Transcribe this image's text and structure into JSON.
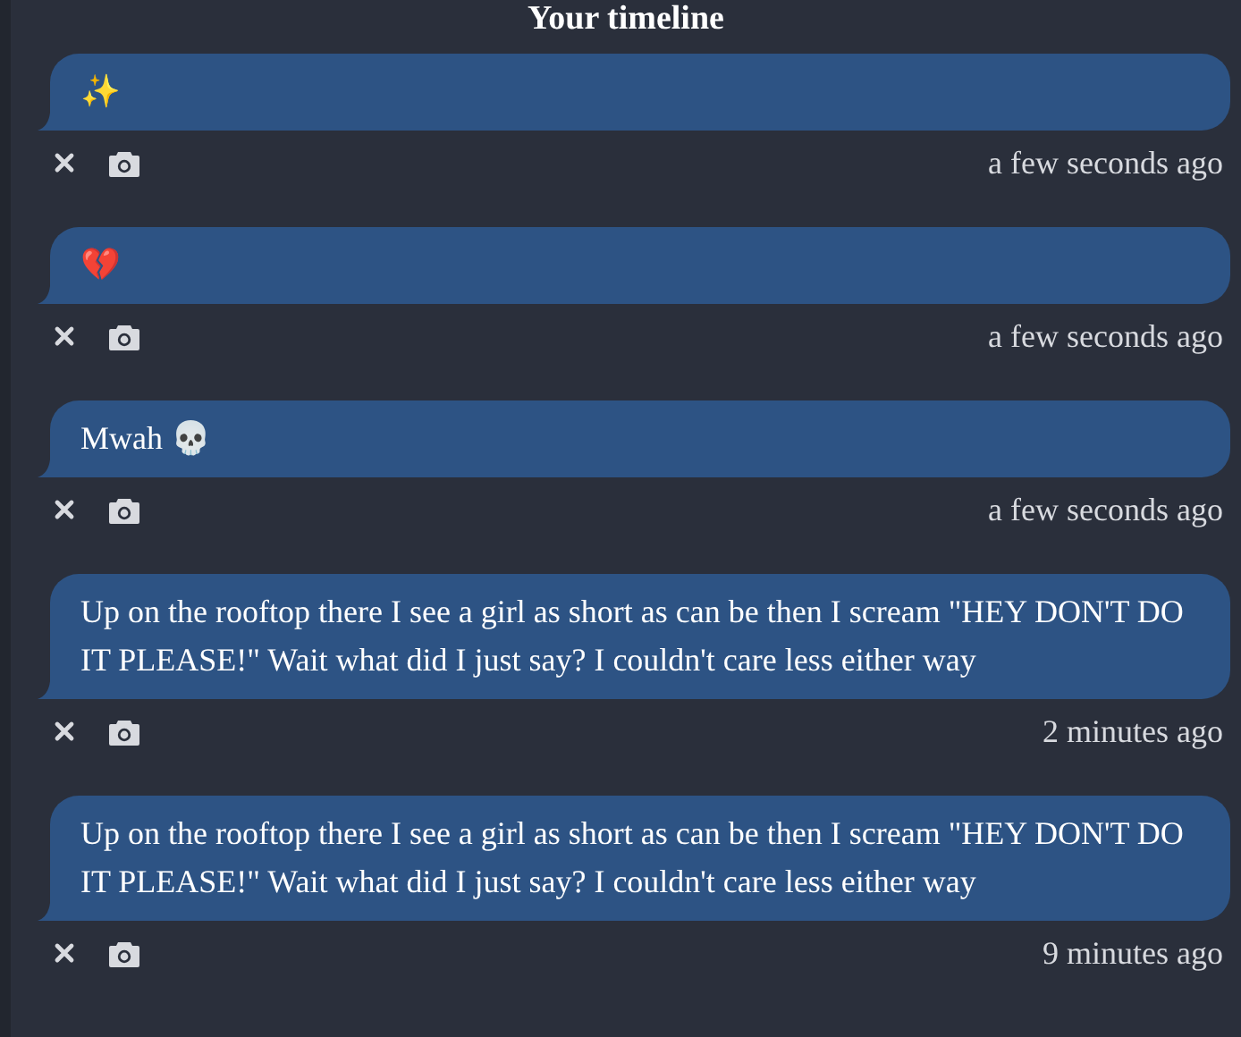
{
  "title": "Your timeline",
  "posts": [
    {
      "text": "✨",
      "time": "a few seconds ago"
    },
    {
      "text": "💔",
      "time": "a few seconds ago"
    },
    {
      "text": "Mwah 💀",
      "time": "a few seconds ago"
    },
    {
      "text": "Up on the rooftop there I see a girl as short as can be then I scream \"HEY DON'T DO IT PLEASE!\" Wait what did I just say? I couldn't care less either way",
      "time": "2 minutes ago"
    },
    {
      "text": "Up on the rooftop there I see a girl as short as can be then I scream \"HEY DON'T DO IT PLEASE!\" Wait what did I just say? I couldn't care less either way",
      "time": "9 minutes ago"
    }
  ]
}
